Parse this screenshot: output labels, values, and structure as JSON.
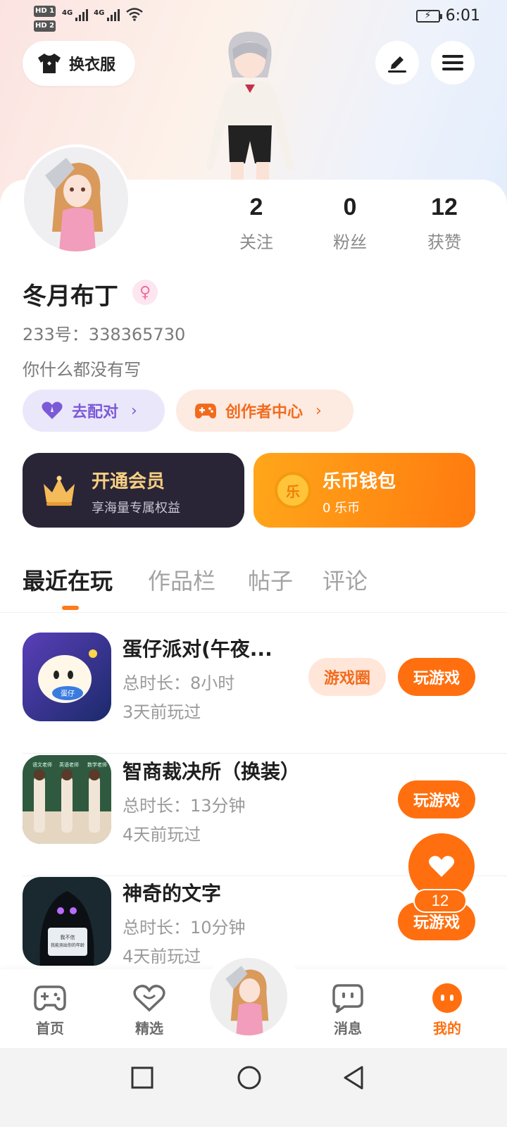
{
  "status_bar": {
    "network_label_1": "HD 1",
    "network_label_2": "HD 2",
    "signal_1": "4G",
    "signal_2": "4G",
    "time": "6:01"
  },
  "header": {
    "dress_button_label": "换衣服",
    "dress_icon": "tshirt-icon",
    "edit_icon": "pencil-icon",
    "menu_icon": "hamburger-menu-icon"
  },
  "profile": {
    "stats": [
      {
        "value": "2",
        "label": "关注"
      },
      {
        "value": "0",
        "label": "粉丝"
      },
      {
        "value": "12",
        "label": "获赞"
      }
    ],
    "username": "冬月布丁",
    "gender_symbol": "♀",
    "uid": "233号：338365730",
    "bio": "你什么都没有写",
    "actions": [
      {
        "label": "去配对",
        "icon": "heart-icon"
      },
      {
        "label": "创作者中心",
        "icon": "gamepad-icon"
      }
    ]
  },
  "banners": {
    "vip": {
      "title": "开通会员",
      "subtitle": "享海量专属权益",
      "icon": "crown-icon"
    },
    "wallet": {
      "title": "乐币钱包",
      "subtitle": "0 乐币",
      "coin_char": "乐"
    }
  },
  "tabs": [
    "最近在玩",
    "作品栏",
    "帖子",
    "评论"
  ],
  "games": [
    {
      "title": "蛋仔派对(午夜...",
      "duration": "总时长：8小时",
      "last_played": "3天前玩过",
      "circle_label": "游戏圈",
      "play_label": "玩游戏"
    },
    {
      "title": "智商裁决所（换装）",
      "duration": "总时长：13分钟",
      "last_played": "4天前玩过",
      "play_label": "玩游戏"
    },
    {
      "title": "神奇的文字",
      "duration": "总时长：10分钟",
      "last_played": "4天前玩过",
      "play_label": "玩游戏"
    }
  ],
  "game_icon_texts": {
    "g1_badge": "蛋仔",
    "g2_labels": [
      "语文老师",
      "英语老师",
      "数学老师"
    ],
    "g3_line1": "我不信",
    "g3_line2": "我能测出你的年龄"
  },
  "float_like": {
    "count": "12"
  },
  "bottom_nav": [
    {
      "label": "首页",
      "icon": "gamepad-icon"
    },
    {
      "label": "精选",
      "icon": "heart-chat-icon"
    },
    {
      "label": "消息",
      "icon": "message-icon"
    },
    {
      "label": "我的",
      "icon": "face-icon"
    }
  ],
  "colors": {
    "accent": "#ff6f0f",
    "match_purple": "#7b5ad8",
    "vip_bg": "#2a2536",
    "vip_gold": "#f7cf82"
  }
}
